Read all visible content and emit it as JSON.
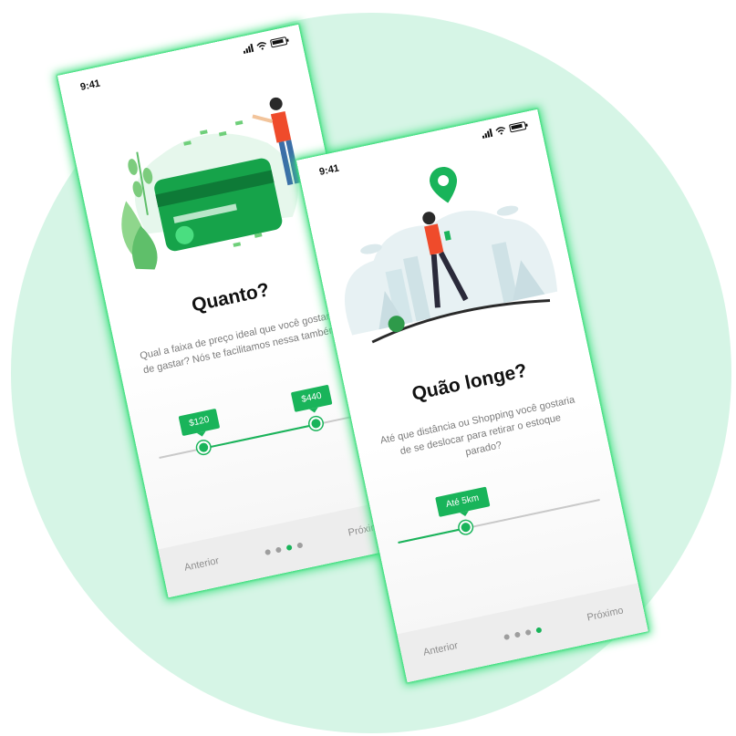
{
  "screens": [
    {
      "status_time": "9:41",
      "title": "Quanto?",
      "description": "Qual a faixa de preço ideal que você gostaria de gastar? Nós te facilitamos nessa também.",
      "slider_min_label": "$120",
      "slider_max_label": "$440",
      "slider_min_fraction": 0.22,
      "slider_max_fraction": 0.78,
      "prev_label": "Anterior",
      "next_label": "Próximo",
      "page_index": 3,
      "page_count": 4
    },
    {
      "status_time": "9:41",
      "title": "Quão longe?",
      "description": "Até que distância ou Shopping você gostaria de se deslocar para retirar o estoque parado?",
      "slider_label": "Até 5km",
      "slider_fraction": 0.34,
      "prev_label": "Anterior",
      "next_label": "Próximo",
      "page_index": 4,
      "page_count": 4
    }
  ],
  "colors": {
    "accent": "#19b45a",
    "glow": "#3ee07f",
    "background_circle": "#d6f5e6"
  },
  "icons": [
    "signal-icon",
    "wifi-icon",
    "battery-icon",
    "location-pin-icon"
  ]
}
